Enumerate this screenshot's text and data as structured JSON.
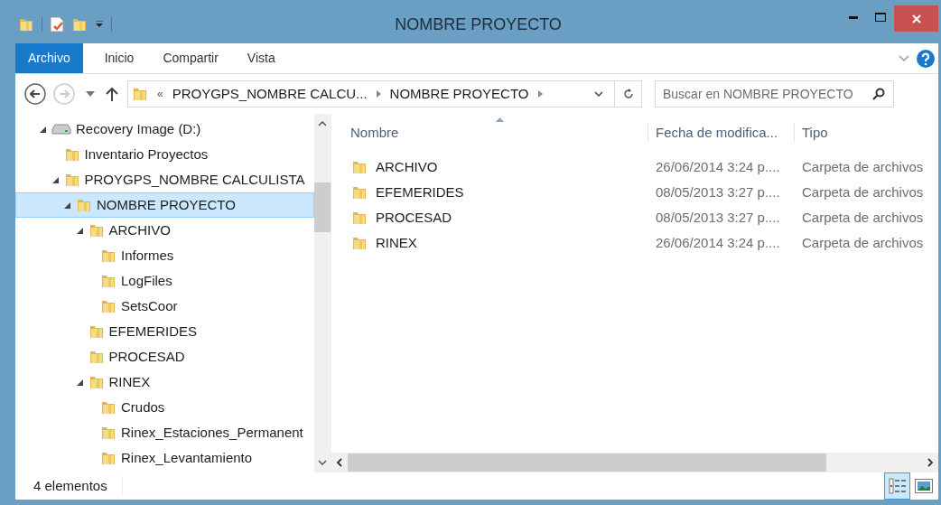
{
  "window": {
    "title": "NOMBRE PROYECTO"
  },
  "ribbon_tabs": [
    {
      "label": "Archivo",
      "selected": true
    },
    {
      "label": "Inicio",
      "selected": false
    },
    {
      "label": "Compartir",
      "selected": false
    },
    {
      "label": "Vista",
      "selected": false
    }
  ],
  "address_bar": {
    "overflow": "«",
    "segments": [
      "PROYGPS_NOMBRE CALCU...",
      "NOMBRE PROYECTO"
    ]
  },
  "search": {
    "placeholder": "Buscar en NOMBRE PROYECTO"
  },
  "tree": [
    {
      "label": "Recovery Image (D:)",
      "kind": "drive",
      "expanded": true,
      "selected": false,
      "children": [
        {
          "label": "Inventario Proyectos",
          "kind": "folder",
          "selected": false
        },
        {
          "label": "PROYGPS_NOMBRE CALCULISTA",
          "kind": "folder",
          "expanded": true,
          "selected": false,
          "children": [
            {
              "label": "NOMBRE PROYECTO",
              "kind": "folder",
              "expanded": true,
              "selected": true,
              "children": [
                {
                  "label": "ARCHIVO",
                  "kind": "folder",
                  "expanded": true,
                  "selected": false,
                  "children": [
                    {
                      "label": "Informes",
                      "kind": "folder",
                      "selected": false
                    },
                    {
                      "label": "LogFiles",
                      "kind": "folder",
                      "selected": false
                    },
                    {
                      "label": "SetsCoor",
                      "kind": "folder",
                      "selected": false
                    }
                  ]
                },
                {
                  "label": "EFEMERIDES",
                  "kind": "folder",
                  "selected": false
                },
                {
                  "label": "PROCESAD",
                  "kind": "folder",
                  "selected": false
                },
                {
                  "label": "RINEX",
                  "kind": "folder",
                  "expanded": true,
                  "selected": false,
                  "children": [
                    {
                      "label": "Crudos",
                      "kind": "folder",
                      "selected": false
                    },
                    {
                      "label": "Rinex_Estaciones_Permanent",
                      "kind": "folder",
                      "selected": false
                    },
                    {
                      "label": "Rinex_Levantamiento",
                      "kind": "folder",
                      "selected": false
                    }
                  ]
                }
              ]
            }
          ]
        }
      ]
    }
  ],
  "file_list": {
    "columns": [
      "Nombre",
      "Fecha de modifica...",
      "Tipo"
    ],
    "rows": [
      {
        "name": "ARCHIVO",
        "date": "26/06/2014 3:24 p....",
        "type": "Carpeta de archivos"
      },
      {
        "name": "EFEMERIDES",
        "date": "08/05/2013 3:27 p....",
        "type": "Carpeta de archivos"
      },
      {
        "name": "PROCESAD",
        "date": "08/05/2013 3:27 p....",
        "type": "Carpeta de archivos"
      },
      {
        "name": "RINEX",
        "date": "26/06/2014 3:24 p....",
        "type": "Carpeta de archivos"
      }
    ]
  },
  "status_bar": {
    "count": "4 elementos",
    "views": [
      {
        "kind": "details",
        "selected": true
      },
      {
        "kind": "thumbnails",
        "selected": false
      }
    ]
  }
}
